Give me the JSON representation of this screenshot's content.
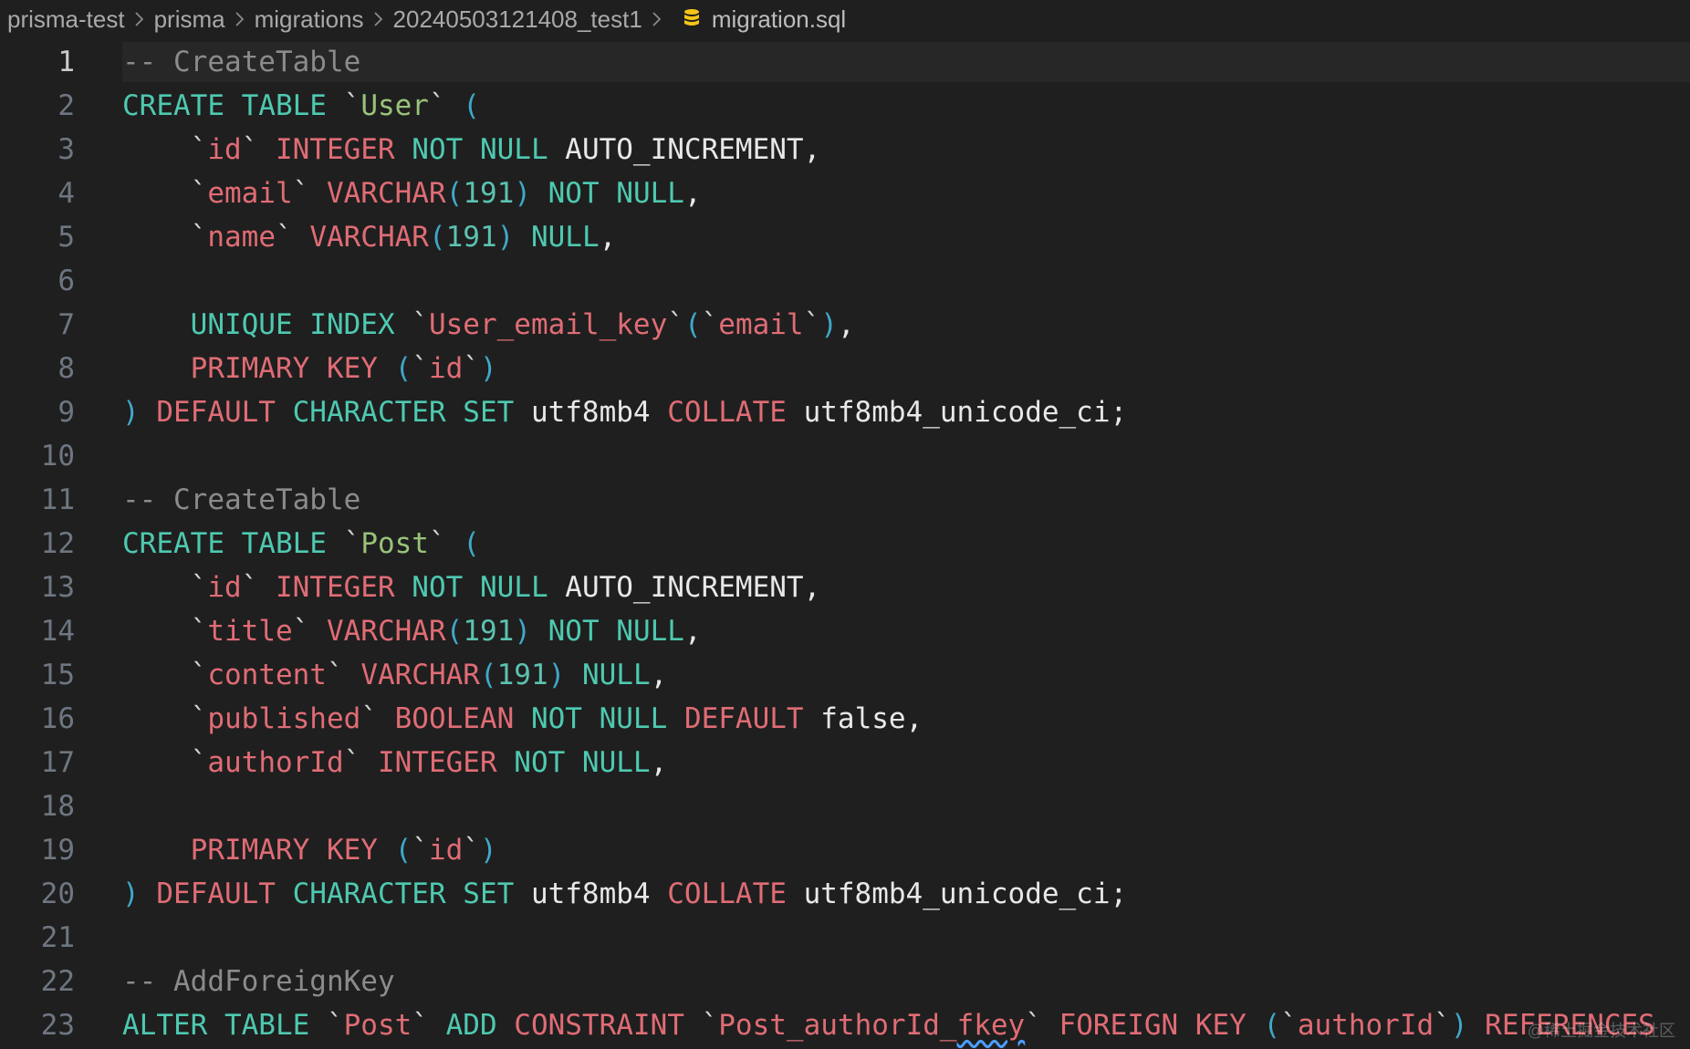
{
  "breadcrumb": {
    "items": [
      "prisma-test",
      "prisma",
      "migrations",
      "20240503121408_test1"
    ],
    "file": "migration.sql",
    "file_icon": "database-icon"
  },
  "editor": {
    "active_line": 1,
    "lines": [
      {
        "n": "1",
        "tokens": [
          [
            "c",
            "-- CreateTable"
          ]
        ]
      },
      {
        "n": "2",
        "tokens": [
          [
            "k",
            "CREATE TABLE "
          ],
          [
            "bt",
            "`"
          ],
          [
            "nm",
            "User"
          ],
          [
            "bt",
            "` "
          ],
          [
            "p",
            "("
          ]
        ]
      },
      {
        "n": "3",
        "tokens": [
          [
            "t",
            "    "
          ],
          [
            "bt",
            "`"
          ],
          [
            "r",
            "id"
          ],
          [
            "bt",
            "` "
          ],
          [
            "r",
            "INTEGER "
          ],
          [
            "k",
            "NOT NULL "
          ],
          [
            "t",
            "AUTO_INCREMENT,"
          ]
        ]
      },
      {
        "n": "4",
        "tokens": [
          [
            "t",
            "    "
          ],
          [
            "bt",
            "`"
          ],
          [
            "r",
            "email"
          ],
          [
            "bt",
            "` "
          ],
          [
            "r",
            "VARCHAR"
          ],
          [
            "p",
            "("
          ],
          [
            "n",
            "191"
          ],
          [
            "p",
            ") "
          ],
          [
            "k",
            "NOT NULL"
          ],
          [
            "t",
            ","
          ]
        ]
      },
      {
        "n": "5",
        "tokens": [
          [
            "t",
            "    "
          ],
          [
            "bt",
            "`"
          ],
          [
            "r",
            "name"
          ],
          [
            "bt",
            "` "
          ],
          [
            "r",
            "VARCHAR"
          ],
          [
            "p",
            "("
          ],
          [
            "n",
            "191"
          ],
          [
            "p",
            ") "
          ],
          [
            "k",
            "NULL"
          ],
          [
            "t",
            ","
          ]
        ]
      },
      {
        "n": "6",
        "tokens": []
      },
      {
        "n": "7",
        "tokens": [
          [
            "t",
            "    "
          ],
          [
            "k",
            "UNIQUE INDEX "
          ],
          [
            "bt",
            "`"
          ],
          [
            "r",
            "User_email_key"
          ],
          [
            "bt",
            "`"
          ],
          [
            "p",
            "("
          ],
          [
            "bt",
            "`"
          ],
          [
            "r",
            "email"
          ],
          [
            "bt",
            "`"
          ],
          [
            "p",
            ")"
          ],
          [
            "t",
            ","
          ]
        ]
      },
      {
        "n": "8",
        "tokens": [
          [
            "t",
            "    "
          ],
          [
            "r",
            "PRIMARY KEY "
          ],
          [
            "p",
            "("
          ],
          [
            "bt",
            "`"
          ],
          [
            "r",
            "id"
          ],
          [
            "bt",
            "`"
          ],
          [
            "p",
            ")"
          ]
        ]
      },
      {
        "n": "9",
        "tokens": [
          [
            "p",
            ") "
          ],
          [
            "r",
            "DEFAULT "
          ],
          [
            "k",
            "CHARACTER SET "
          ],
          [
            "t",
            "utf8mb4 "
          ],
          [
            "r",
            "COLLATE "
          ],
          [
            "t",
            "utf8mb4_unicode_ci;"
          ]
        ]
      },
      {
        "n": "10",
        "tokens": []
      },
      {
        "n": "11",
        "tokens": [
          [
            "c",
            "-- CreateTable"
          ]
        ]
      },
      {
        "n": "12",
        "tokens": [
          [
            "k",
            "CREATE TABLE "
          ],
          [
            "bt",
            "`"
          ],
          [
            "nm",
            "Post"
          ],
          [
            "bt",
            "` "
          ],
          [
            "p",
            "("
          ]
        ]
      },
      {
        "n": "13",
        "tokens": [
          [
            "t",
            "    "
          ],
          [
            "bt",
            "`"
          ],
          [
            "r",
            "id"
          ],
          [
            "bt",
            "` "
          ],
          [
            "r",
            "INTEGER "
          ],
          [
            "k",
            "NOT NULL "
          ],
          [
            "t",
            "AUTO_INCREMENT,"
          ]
        ]
      },
      {
        "n": "14",
        "tokens": [
          [
            "t",
            "    "
          ],
          [
            "bt",
            "`"
          ],
          [
            "r",
            "title"
          ],
          [
            "bt",
            "` "
          ],
          [
            "r",
            "VARCHAR"
          ],
          [
            "p",
            "("
          ],
          [
            "n",
            "191"
          ],
          [
            "p",
            ") "
          ],
          [
            "k",
            "NOT NULL"
          ],
          [
            "t",
            ","
          ]
        ]
      },
      {
        "n": "15",
        "tokens": [
          [
            "t",
            "    "
          ],
          [
            "bt",
            "`"
          ],
          [
            "r",
            "content"
          ],
          [
            "bt",
            "` "
          ],
          [
            "r",
            "VARCHAR"
          ],
          [
            "p",
            "("
          ],
          [
            "n",
            "191"
          ],
          [
            "p",
            ") "
          ],
          [
            "k",
            "NULL"
          ],
          [
            "t",
            ","
          ]
        ]
      },
      {
        "n": "16",
        "tokens": [
          [
            "t",
            "    "
          ],
          [
            "bt",
            "`"
          ],
          [
            "r",
            "published"
          ],
          [
            "bt",
            "` "
          ],
          [
            "r",
            "BOOLEAN "
          ],
          [
            "k",
            "NOT NULL "
          ],
          [
            "r",
            "DEFAULT "
          ],
          [
            "t",
            "false,"
          ]
        ]
      },
      {
        "n": "17",
        "tokens": [
          [
            "t",
            "    "
          ],
          [
            "bt",
            "`"
          ],
          [
            "r",
            "authorId"
          ],
          [
            "bt",
            "` "
          ],
          [
            "r",
            "INTEGER "
          ],
          [
            "k",
            "NOT NULL"
          ],
          [
            "t",
            ","
          ]
        ]
      },
      {
        "n": "18",
        "tokens": []
      },
      {
        "n": "19",
        "tokens": [
          [
            "t",
            "    "
          ],
          [
            "r",
            "PRIMARY KEY "
          ],
          [
            "p",
            "("
          ],
          [
            "bt",
            "`"
          ],
          [
            "r",
            "id"
          ],
          [
            "bt",
            "`"
          ],
          [
            "p",
            ")"
          ]
        ]
      },
      {
        "n": "20",
        "tokens": [
          [
            "p",
            ") "
          ],
          [
            "r",
            "DEFAULT "
          ],
          [
            "k",
            "CHARACTER SET "
          ],
          [
            "t",
            "utf8mb4 "
          ],
          [
            "r",
            "COLLATE "
          ],
          [
            "t",
            "utf8mb4_unicode_ci;"
          ]
        ]
      },
      {
        "n": "21",
        "tokens": []
      },
      {
        "n": "22",
        "tokens": [
          [
            "c",
            "-- AddForeignKey"
          ]
        ]
      },
      {
        "n": "23",
        "tokens": [
          [
            "k",
            "ALTER TABLE "
          ],
          [
            "bt",
            "`"
          ],
          [
            "r",
            "Post"
          ],
          [
            "bt",
            "` "
          ],
          [
            "k",
            "ADD "
          ],
          [
            "r",
            "CONSTRAINT "
          ],
          [
            "bt",
            "`"
          ],
          [
            "r",
            "Post_authorId_"
          ],
          [
            "rw",
            "fkey"
          ],
          [
            "bt",
            "` "
          ],
          [
            "r",
            "FOREIGN KEY "
          ],
          [
            "p",
            "("
          ],
          [
            "bt",
            "`"
          ],
          [
            "r",
            "authorId"
          ],
          [
            "bt",
            "`"
          ],
          [
            "p",
            ") "
          ],
          [
            "r",
            "REFERENCES"
          ]
        ]
      }
    ]
  },
  "watermark": "@稀土掘金技术社区"
}
